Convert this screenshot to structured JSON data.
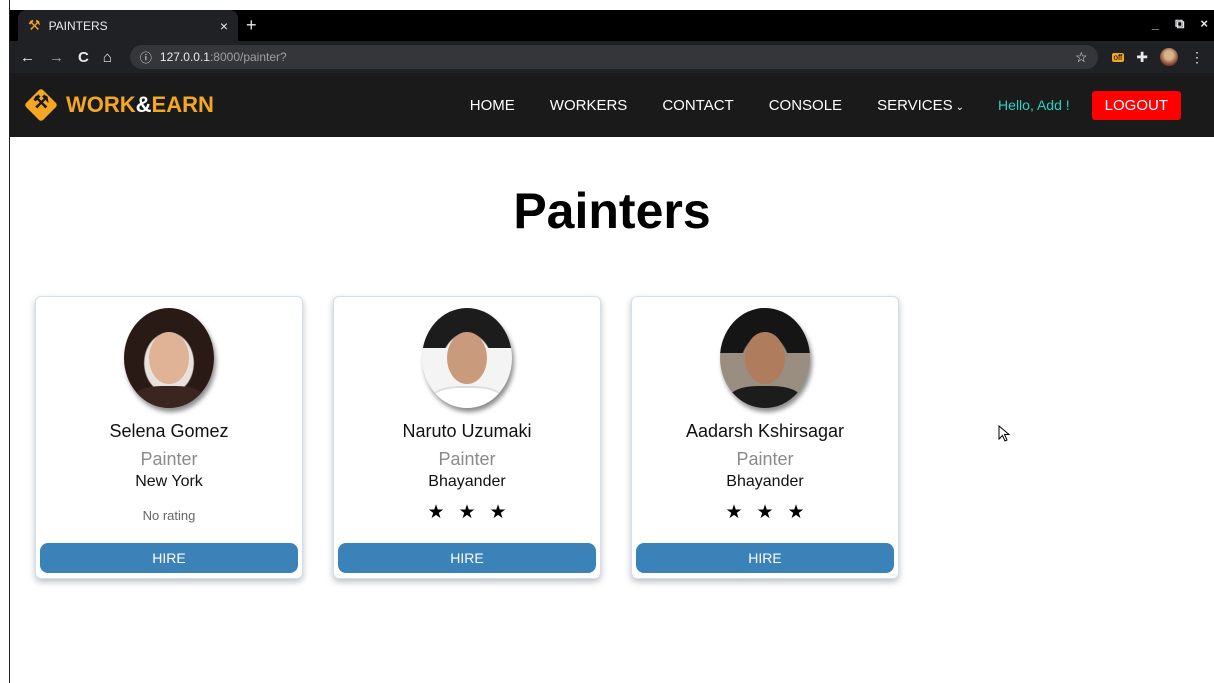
{
  "browser": {
    "tab_title": "PAINTERS",
    "tab_close": "×",
    "new_tab": "+",
    "url_host": "127.0.0.1",
    "url_rest": ":8000/painter?",
    "back": "←",
    "forward": "→",
    "reload": "C",
    "home": "⌂",
    "info": "ⓘ",
    "star": "☆",
    "ext_badge": "off",
    "ext_puzzle": "✚",
    "menu": "⋮",
    "win_min": "_",
    "win_max": "⧉",
    "win_close": "×"
  },
  "navbar": {
    "brand_work": "WORK",
    "brand_amp": "&",
    "brand_earn": "EARN",
    "links": [
      "HOME",
      "WORKERS",
      "CONTACT",
      "CONSOLE",
      "SERVICES"
    ],
    "services_chevron": "⌄",
    "greeting": "Hello, Add !",
    "logout": "LOGOUT"
  },
  "page": {
    "title": "Painters"
  },
  "workers": [
    {
      "name": "Selena Gomez",
      "role": "Painter",
      "city": "New York",
      "rating_text": "No rating",
      "stars": "",
      "hire": "HIRE"
    },
    {
      "name": "Naruto Uzumaki",
      "role": "Painter",
      "city": "Bhayander",
      "rating_text": "",
      "stars": "★★★",
      "hire": "HIRE"
    },
    {
      "name": "Aadarsh Kshirsagar",
      "role": "Painter",
      "city": "Bhayander",
      "rating_text": "",
      "stars": "★★★",
      "hire": "HIRE"
    }
  ],
  "colors": {
    "brand": "#f5a623",
    "navbar_bg": "#1a1a1a",
    "greeting": "#27d3c6",
    "logout_bg": "#ff0000",
    "hire_bg": "#3b82b8"
  }
}
